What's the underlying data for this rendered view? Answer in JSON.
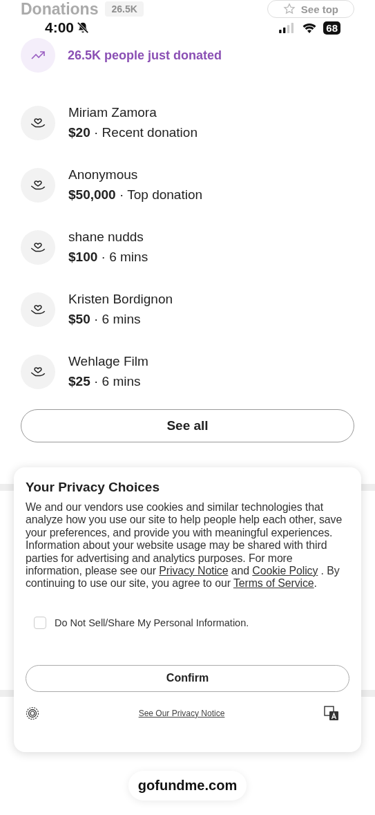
{
  "header": {
    "title": "Donations",
    "count": "26.5K",
    "see_top_button": "See top"
  },
  "status_bar": {
    "time": "4:00",
    "battery": "68"
  },
  "trend": {
    "text": "26.5K people just donated"
  },
  "donations": [
    {
      "name": "Miriam Zamora",
      "detail": "**$20** · Recent donation"
    },
    {
      "name": "Anonymous",
      "detail": "**$50,000** · Top donation"
    },
    {
      "name": "shane nudds",
      "detail": "**$100** · 6 mins"
    },
    {
      "name": "Kristen Bordignon",
      "detail": "**$50** · 6 mins"
    },
    {
      "name": "Wehlage Film",
      "detail": "**$25** · 6 mins"
    }
  ],
  "see_all_button": "See all",
  "privacy_dialog": {
    "title": "Your Privacy Choices",
    "body": [
      {
        "kind": "text",
        "text": "We and our vendors use cookies and similar technologies that analyze how you use our site to help people help each other, save your preferences, and provide you with meaningful experiences. Information about your website usage may be shared with third parties for advertising and analytics purposes. For more information, please see our "
      },
      {
        "kind": "link",
        "text": "Privacy Notice"
      },
      {
        "kind": "text",
        "text": " and "
      },
      {
        "kind": "link",
        "text": "Cookie Policy"
      },
      {
        "kind": "text",
        "text": " . By continuing to use our site, you agree to our "
      },
      {
        "kind": "link",
        "text": "Terms of Service"
      },
      {
        "kind": "text",
        "text": "."
      }
    ],
    "option": {
      "label": "Do Not Sell/Share My Personal Information.",
      "checked": false
    },
    "confirm_button": "Confirm",
    "footer_link": "See Our Privacy Notice"
  },
  "url_bar": "gofundme.com"
}
